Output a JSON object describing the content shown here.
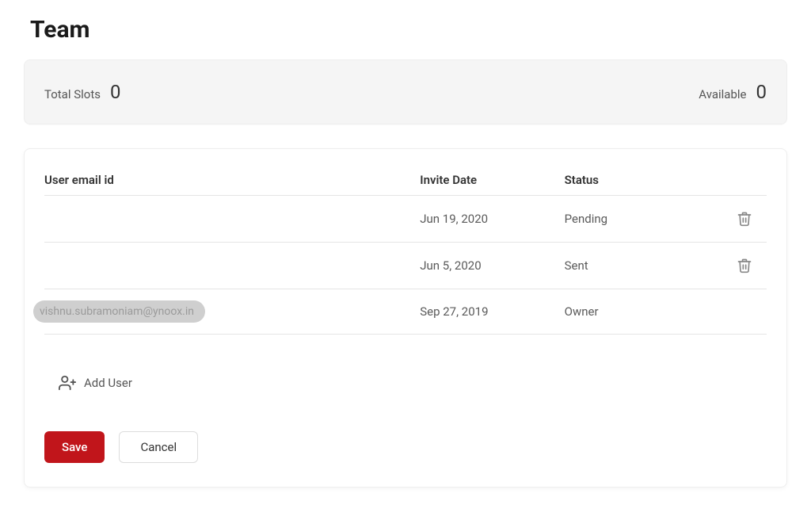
{
  "page": {
    "title": "Team"
  },
  "summary": {
    "totalSlots": {
      "label": "Total Slots",
      "value": "0"
    },
    "available": {
      "label": "Available",
      "value": "0"
    }
  },
  "table": {
    "headers": {
      "email": "User email id",
      "inviteDate": "Invite Date",
      "status": "Status"
    },
    "rows": [
      {
        "email": "",
        "inviteDate": "Jun 19, 2020",
        "status": "Pending",
        "deletable": true
      },
      {
        "email": "",
        "inviteDate": "Jun 5, 2020",
        "status": "Sent",
        "deletable": true
      },
      {
        "email": "vishnu.subramoniam@ynoox.in",
        "inviteDate": "Sep 27, 2019",
        "status": "Owner",
        "deletable": false
      }
    ]
  },
  "addUser": {
    "label": "Add User"
  },
  "buttons": {
    "save": "Save",
    "cancel": "Cancel"
  }
}
